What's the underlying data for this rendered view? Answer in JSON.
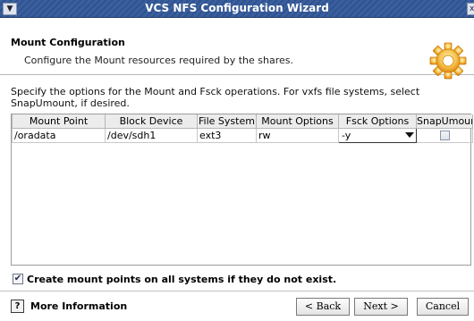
{
  "window": {
    "title": "VCS NFS Configuration Wizard"
  },
  "header": {
    "title": "Mount Configuration",
    "subtitle": "Configure the Mount resources required by the shares."
  },
  "description": "Specify the options for the Mount and Fsck operations. For vxfs file systems, select SnapUmount, if desired.",
  "table": {
    "columns": [
      "Mount Point",
      "Block Device",
      "File System",
      "Mount Options",
      "Fsck Options",
      "SnapUmount"
    ],
    "rows": [
      {
        "mount_point": "/oradata",
        "block_device": "/dev/sdh1",
        "file_system": "ext3",
        "mount_options": "rw",
        "fsck_options": "-y",
        "snapumount": false
      }
    ]
  },
  "create_mount_points": {
    "label": "Create mount points on all systems if they do not exist.",
    "checked": true
  },
  "footer": {
    "more_info": "More Information",
    "help_glyph": "?",
    "back": "< Back",
    "next": "Next >",
    "cancel": "Cancel"
  },
  "colors": {
    "titlebar": "#3a5f9c",
    "accent": "#f2a41c"
  }
}
